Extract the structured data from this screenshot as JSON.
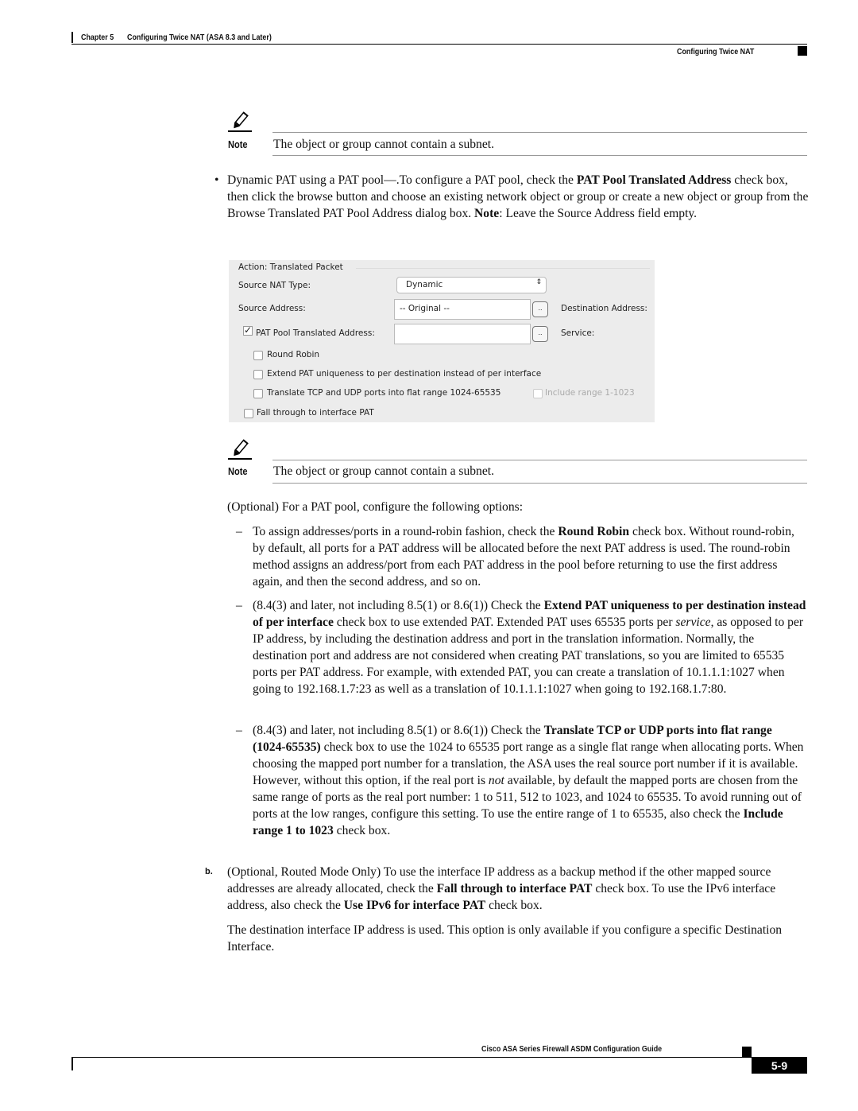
{
  "header": {
    "chapter": "Chapter 5",
    "chapter_title": "Configuring Twice NAT (ASA 8.3 and Later)",
    "section": "Configuring Twice NAT"
  },
  "note1": {
    "label": "Note",
    "text": "The object or group cannot contain a subnet.",
    "icon": "pencil-icon"
  },
  "bullet_para": [
    {
      "t": "Dynamic PAT using a PAT pool—.To configure a PAT pool, check the "
    },
    {
      "t": "PAT Pool Translated Address",
      "b": true
    },
    {
      "t": " check box, then click the browse button and choose an existing network object or group or create a new object or group from the Browse Translated PAT Pool Address dialog box. "
    },
    {
      "t": "Note",
      "b": true
    },
    {
      "t": ": Leave the Source Address field empty."
    }
  ],
  "ui": {
    "group_title": "Action: Translated Packet",
    "source_nat_type_label": "Source NAT Type:",
    "source_nat_type_value": "Dynamic",
    "source_address_label": "Source Address:",
    "source_address_value": "-- Original --",
    "destination_address_label": "Destination Address:",
    "pat_pool_label": "PAT Pool Translated Address:",
    "pat_pool_checked": true,
    "pat_pool_value": "",
    "service_label": "Service:",
    "browse_label": "..",
    "round_robin": "Round Robin",
    "extend_pat": "Extend PAT uniqueness to per destination instead of per interface",
    "translate_flat": "Translate TCP and UDP ports into flat range 1024-65535",
    "include_range": "Include range 1-1023",
    "fall_through": "Fall through to interface PAT"
  },
  "note2": {
    "label": "Note",
    "text": "The object or group cannot contain a subnet."
  },
  "optional_para": "(Optional) For a PAT pool, configure the following options:",
  "dash_items": [
    [
      {
        "t": "To assign addresses/ports in a round-robin fashion, check the "
      },
      {
        "t": "Round Robin",
        "b": true
      },
      {
        "t": " check box. Without round-robin, by default, all ports for a PAT address will be allocated before the next PAT address is used. The round-robin method assigns an address/port from each PAT address in the pool before returning to use the first address again, and then the second address, and so on."
      }
    ],
    [
      {
        "t": "(8.4(3) and later, not including 8.5(1) or 8.6(1)) Check the "
      },
      {
        "t": "Extend PAT uniqueness to per destination instead of per interface",
        "b": true
      },
      {
        "t": " check box to use extended PAT. Extended PAT uses 65535 ports per "
      },
      {
        "t": "service",
        "i": true
      },
      {
        "t": ", as opposed to per IP address, by including the destination address and port in the translation information. Normally, the destination port and address are not considered when creating PAT translations, so you are limited to 65535 ports per PAT address. For example, with extended PAT, you can create a translation of 10.1.1.1:1027 when going to 192.168.1.7:23 as well as a translation of 10.1.1.1:1027 when going to 192.168.1.7:80."
      }
    ],
    [
      {
        "t": "(8.4(3) and later, not including 8.5(1) or 8.6(1)) Check the "
      },
      {
        "t": "Translate TCP or UDP ports into flat range (1024-65535)",
        "b": true
      },
      {
        "t": " check box to use the 1024 to 65535 port range as a single flat range when allocating ports. When choosing the mapped port number for a translation, the ASA uses the real source port number if it is available. However, without this option, if the real port is "
      },
      {
        "t": "not",
        "i": true
      },
      {
        "t": " available, by default the mapped ports are chosen from the same range of ports as the real port number: 1 to 511, 512 to 1023, and 1024 to 65535. To avoid running out of ports at the low ranges, configure this setting. To use the entire range of 1 to 65535, also check the "
      },
      {
        "t": "Include range 1 to 1023",
        "b": true
      },
      {
        "t": " check box."
      }
    ]
  ],
  "step_b": {
    "label": "b.",
    "segments": [
      {
        "t": "(Optional, Routed Mode Only) To use the interface IP address as a backup method if the other mapped source addresses are already allocated, check the "
      },
      {
        "t": "Fall through to interface PAT",
        "b": true
      },
      {
        "t": " check box. To use the IPv6 interface address, also check the "
      },
      {
        "t": "Use IPv6 for interface PAT",
        "b": true
      },
      {
        "t": " check box."
      }
    ]
  },
  "final_para": "The destination interface IP address is used. This option is only available if you configure a specific Destination Interface.",
  "footer": {
    "guide_title": "Cisco ASA Series Firewall ASDM Configuration Guide",
    "page_number": "5-9"
  }
}
